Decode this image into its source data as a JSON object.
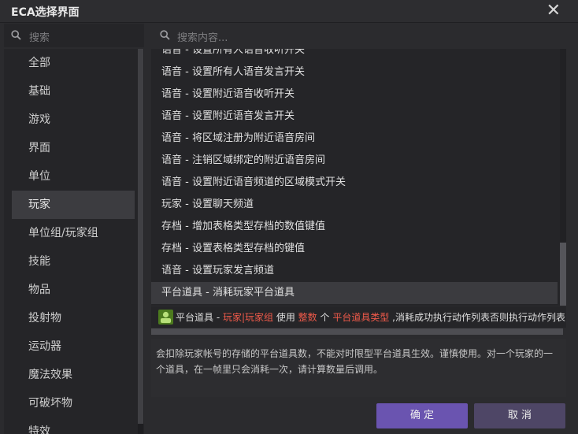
{
  "window": {
    "title": "ECA选择界面"
  },
  "left_search": {
    "placeholder": "搜索"
  },
  "right_search": {
    "placeholder": "搜索内容..."
  },
  "sidebar": {
    "items": [
      {
        "label": "全部"
      },
      {
        "label": "基础"
      },
      {
        "label": "游戏"
      },
      {
        "label": "界面"
      },
      {
        "label": "单位"
      },
      {
        "label": "玩家",
        "selected": true
      },
      {
        "label": "单位组/玩家组"
      },
      {
        "label": "技能"
      },
      {
        "label": "物品"
      },
      {
        "label": "投射物"
      },
      {
        "label": "运动器"
      },
      {
        "label": "魔法效果"
      },
      {
        "label": "可破坏物"
      },
      {
        "label": "特效"
      }
    ]
  },
  "actions": {
    "items": [
      {
        "label": "语音 - 设置所有人语音收听开关"
      },
      {
        "label": "语音 - 设置所有人语音发言开关"
      },
      {
        "label": "语音 - 设置附近语音收听开关"
      },
      {
        "label": "语音 - 设置附近语音发言开关"
      },
      {
        "label": "语音 - 将区域注册为附近语音房间"
      },
      {
        "label": "语音 - 注销区域绑定的附近语音房间"
      },
      {
        "label": "语音 - 设置附近语音频道的区域模式开关"
      },
      {
        "label": "玩家 - 设置聊天频道"
      },
      {
        "label": "存档 - 增加表格类型存档的数值键值"
      },
      {
        "label": "存档 - 设置表格类型存档的键值"
      },
      {
        "label": "语音 - 设置玩家发言频道"
      },
      {
        "label": "平台道具 - 消耗玩家平台道具",
        "selected": true
      }
    ]
  },
  "detail": {
    "prefix": "平台道具 - ",
    "param1": "玩家|玩家组",
    "word1": " 使用 ",
    "param2": "整数",
    "word2": " 个 ",
    "param3": "平台道具类型",
    "suffix": " ,消耗成功执行动作列表否则执行动作列表"
  },
  "description": "会扣除玩家帐号的存储的平台道具数，不能对时限型平台道具生效。谨慎使用。对一个玩家的一个道具，在一帧里只会消耗一次，请计算数量后调用。",
  "buttons": {
    "ok": "确 定",
    "cancel": "取 消"
  },
  "colors": {
    "accent": "#6a54b0",
    "param_red": "#f05a4a",
    "cancel_bg": "#4e4666"
  }
}
